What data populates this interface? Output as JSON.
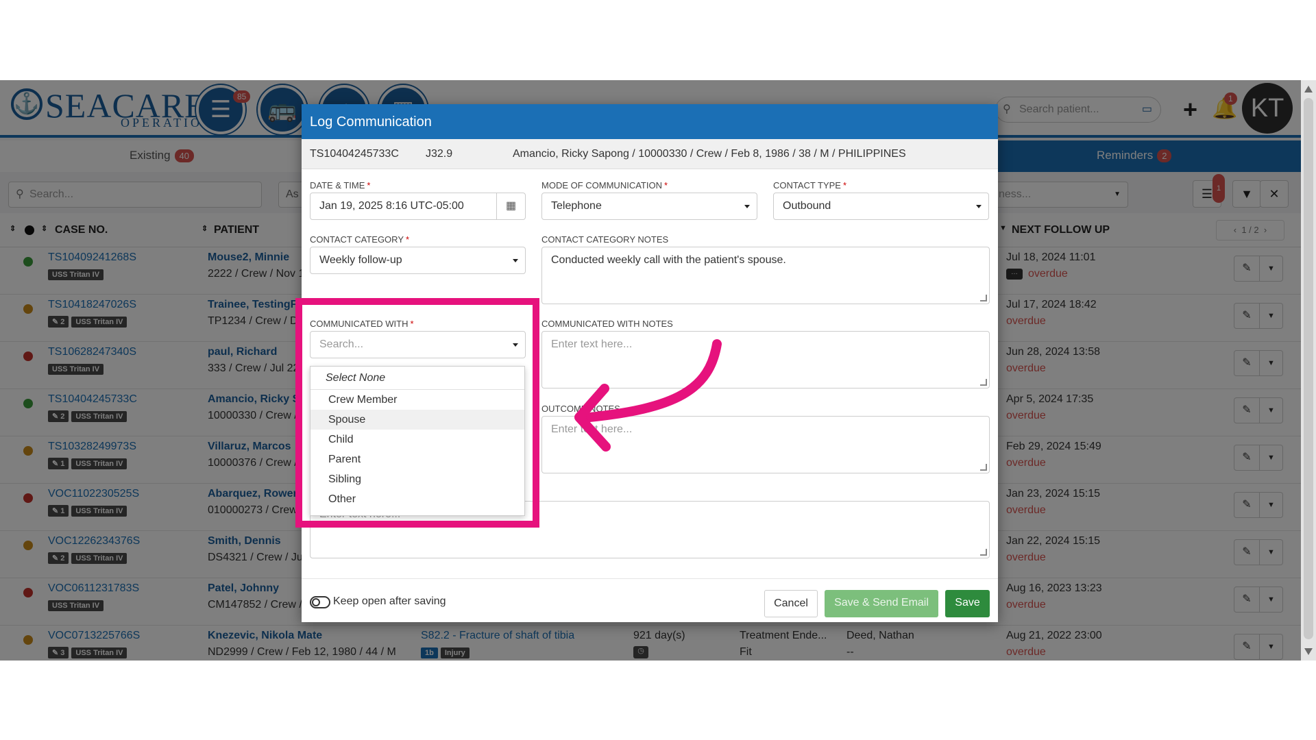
{
  "app": {
    "logo_main": "SEACARE",
    "logo_sub": "OPERATIONS",
    "menu_badge": "85",
    "search_placeholder": "Search patient...",
    "bell_badge": "1",
    "avatar_initials": "KT"
  },
  "tabs": {
    "existing_label": "Existing",
    "existing_count": "40",
    "reminders_label": "Reminders",
    "reminders_count": "2"
  },
  "filters": {
    "search_placeholder": "Search...",
    "as_text": "As",
    "right_text": "ness...",
    "filter_badge": "1"
  },
  "table": {
    "headers": {
      "case_no": "CASE NO.",
      "patient": "PATIENT",
      "next_follow_up": "NEXT FOLLOW UP"
    },
    "pager": "1 / 2",
    "rows": [
      {
        "status_color": "#3a9a3a",
        "case": "TS10409241268S",
        "count_tag": "",
        "vessel": "USS Tritan IV",
        "name": "Mouse2, Minnie",
        "info": "2222 / Crew / Nov 1",
        "follow_date": "Jul 18, 2024 11:01",
        "follow_status": "overdue",
        "chat": true
      },
      {
        "status_color": "#c88a1a",
        "case": "TS10418247026S",
        "count_tag": "2",
        "vessel": "USS Tritan IV",
        "name": "Trainee, TestingF",
        "info": "TP1234 / Crew / D",
        "follow_date": "Jul 17, 2024 18:42",
        "follow_status": "overdue",
        "chat": false
      },
      {
        "status_color": "#c0302a",
        "case": "TS10628247340S",
        "count_tag": "",
        "vessel": "USS Tritan IV",
        "name": "paul, Richard",
        "info": "333 / Crew / Jul 22",
        "follow_date": "Jun 28, 2024 13:58",
        "follow_status": "overdue",
        "chat": false
      },
      {
        "status_color": "#3a9a3a",
        "case": "TS10404245733C",
        "count_tag": "2",
        "vessel": "USS Tritan IV",
        "name": "Amancio, Ricky S",
        "info": "10000330 / Crew /",
        "follow_date": "Apr 5, 2024 17:35",
        "follow_status": "overdue",
        "chat": false
      },
      {
        "status_color": "#c88a1a",
        "case": "TS10328249973S",
        "count_tag": "1",
        "vessel": "USS Tritan IV",
        "name": "Villaruz, Marcos",
        "info": "10000376 / Crew /",
        "follow_date": "Feb 29, 2024 15:49",
        "follow_status": "overdue",
        "chat": false
      },
      {
        "status_color": "#c0302a",
        "case": "VOC1102230525S",
        "count_tag": "1",
        "vessel": "USS Tritan IV",
        "name": "Abarquez, Rower",
        "info": "010000273 / Crew",
        "follow_date": "Jan 23, 2024 15:15",
        "follow_status": "overdue",
        "chat": false
      },
      {
        "status_color": "#c88a1a",
        "case": "VOC1226234376S",
        "count_tag": "2",
        "vessel": "USS Tritan IV",
        "name": "Smith, Dennis",
        "info": "DS4321 / Crew / Ju",
        "follow_date": "Jan 22, 2024 15:15",
        "follow_status": "overdue",
        "chat": false
      },
      {
        "status_color": "#c0302a",
        "case": "VOC0611231783S",
        "count_tag": "",
        "vessel": "USS Tritan IV",
        "name": "Patel, Johnny",
        "info": "CM147852 / Crew /",
        "follow_date": "Aug 16, 2023 13:23",
        "follow_status": "overdue",
        "chat": false
      },
      {
        "status_color": "#c88a1a",
        "case": "VOC0713225766S",
        "count_tag": "3",
        "vessel": "USS Tritan IV",
        "name": "Knezevic, Nikola Mate",
        "info": "ND2999 / Crew / Feb 12, 1980 / 44 / M",
        "diagnosis": "S82.2 - Fracture of shaft of tibia",
        "diag_tags": [
          "1b",
          "Injury"
        ],
        "days": "921 day(s)",
        "status": "Treatment Ende...",
        "status2": "Fit",
        "assignee": "Deed, Nathan",
        "assignee2": "--",
        "follow_date": "Aug 21, 2022 23:00",
        "follow_status": "overdue",
        "chat": false
      }
    ]
  },
  "modal": {
    "title": "Log Communication",
    "case_no": "TS10404245733C",
    "code": "J32.9",
    "patient_info": "Amancio, Ricky Sapong / 10000330 / Crew / Feb 8, 1986 / 38 / M / PHILIPPINES",
    "date_label": "DATE & TIME",
    "date_value": "Jan 19, 2025 8:16 UTC-05:00",
    "mode_label": "MODE OF COMMUNICATION",
    "mode_value": "Telephone",
    "contact_type_label": "CONTACT TYPE",
    "contact_type_value": "Outbound",
    "category_label": "CONTACT CATEGORY",
    "category_value": "Weekly follow-up",
    "category_notes_label": "CONTACT CATEGORY NOTES",
    "category_notes_value": "Conducted weekly call with the patient's spouse.",
    "comm_with_label": "COMMUNICATED WITH",
    "comm_with_placeholder": "Search...",
    "comm_notes_label": "COMMUNICATED WITH NOTES",
    "text_placeholder": "Enter text here...",
    "outcome_notes_label": "OUTCOME NOTES",
    "outcome_placeholder": "Enter text here...",
    "extra_placeholder": "Enter text here...",
    "options": [
      "Select None",
      "Crew Member",
      "Spouse",
      "Child",
      "Parent",
      "Sibling",
      "Other"
    ],
    "keep_open_label": "Keep open after saving",
    "cancel_label": "Cancel",
    "save_send_label": "Save & Send Email",
    "save_label": "Save"
  },
  "colors": {
    "primary": "#1b6fb5",
    "highlight": "#e6127d",
    "save_green": "#2e8b3d",
    "save_send_green": "#7cbf7c"
  }
}
